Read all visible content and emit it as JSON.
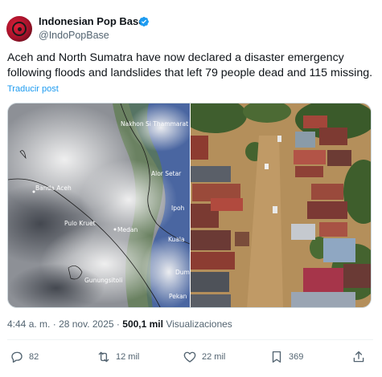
{
  "author": {
    "name": "Indonesian Pop Base",
    "handle": "@IndoPopBase",
    "verified": true,
    "accent_color": "#1d9bf0"
  },
  "tweet": {
    "text": "Aceh and North Sumatra have now declared a disaster emergency following floods and landslides that left 79 people dead and 115 missing.",
    "translate_label": "Traducir post"
  },
  "media": {
    "left": {
      "description_icon": "satellite-map",
      "labels": [
        "Nakhon Si Thammarat",
        "Alor Setar",
        "Banda Aceh",
        "Ipoh",
        "Pulo Kruet",
        "Medan",
        "Kuala",
        "Gunungsitoli",
        "Dum",
        "Pekan"
      ]
    },
    "right": {
      "description_icon": "flood-aerial-photo"
    }
  },
  "meta": {
    "time": "4:44 a. m.",
    "separator": "·",
    "date": "28 nov. 2025",
    "views_count": "500,1 mil",
    "views_label": "Visualizaciones"
  },
  "actions": {
    "replies": "82",
    "reposts": "12 mil",
    "likes": "22 mil",
    "bookmarks": "369"
  }
}
